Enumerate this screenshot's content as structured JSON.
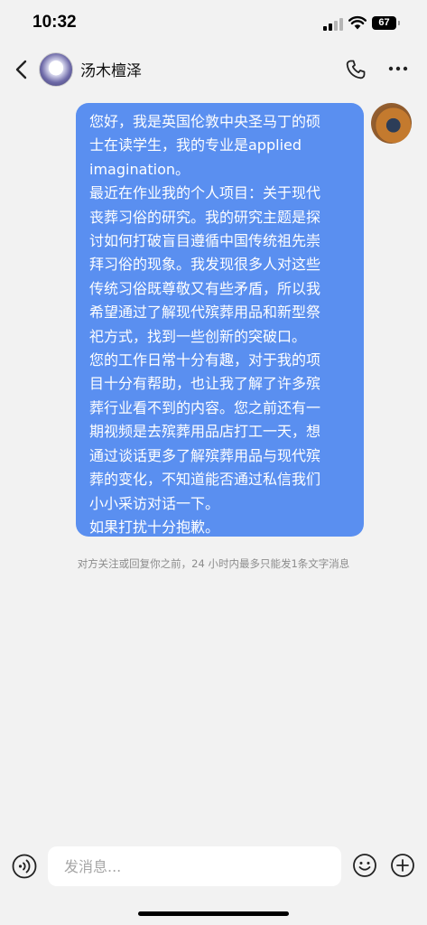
{
  "status_bar": {
    "time": "10:32",
    "battery": "67"
  },
  "header": {
    "contact_name": "汤木檀泽",
    "back_icon": "chevron-left-icon",
    "phone_icon": "phone-icon",
    "more_icon": "more-horizontal-icon"
  },
  "chat": {
    "messages": [
      {
        "sender": "me",
        "text": "您好，我是英国伦敦中央圣马丁的硕\n士在读学生，我的专业是applied\nimagination。\n最近在作业我的个人项目：关于现代\n丧葬习俗的研究。我的研究主题是探\n讨如何打破盲目遵循中国传统祖先崇\n拜习俗的现象。我发现很多人对这些\n传统习俗既尊敬又有些矛盾，所以我\n希望通过了解现代殡葬用品和新型祭\n祀方式，找到一些创新的突破口。\n您的工作日常十分有趣，对于我的项\n目十分有帮助，也让我了解了许多殡\n葬行业看不到的内容。您之前还有一\n期视频是去殡葬用品店打工一天，想\n通过谈话更多了解殡葬用品与现代殡\n葬的变化，不知道能否通过私信我们\n小小采访对话一下。\n如果打扰十分抱歉。"
      }
    ],
    "notice": "对方关注或回复你之前，24 小时内最多只能发1条文字消息"
  },
  "input_bar": {
    "placeholder": "发消息...",
    "voice_icon": "voice-icon",
    "emoji_icon": "emoji-icon",
    "plus_icon": "plus-icon"
  },
  "colors": {
    "bubble": "#5a8ff0",
    "background": "#f2f2f2",
    "notice_text": "#8c8c8c"
  }
}
